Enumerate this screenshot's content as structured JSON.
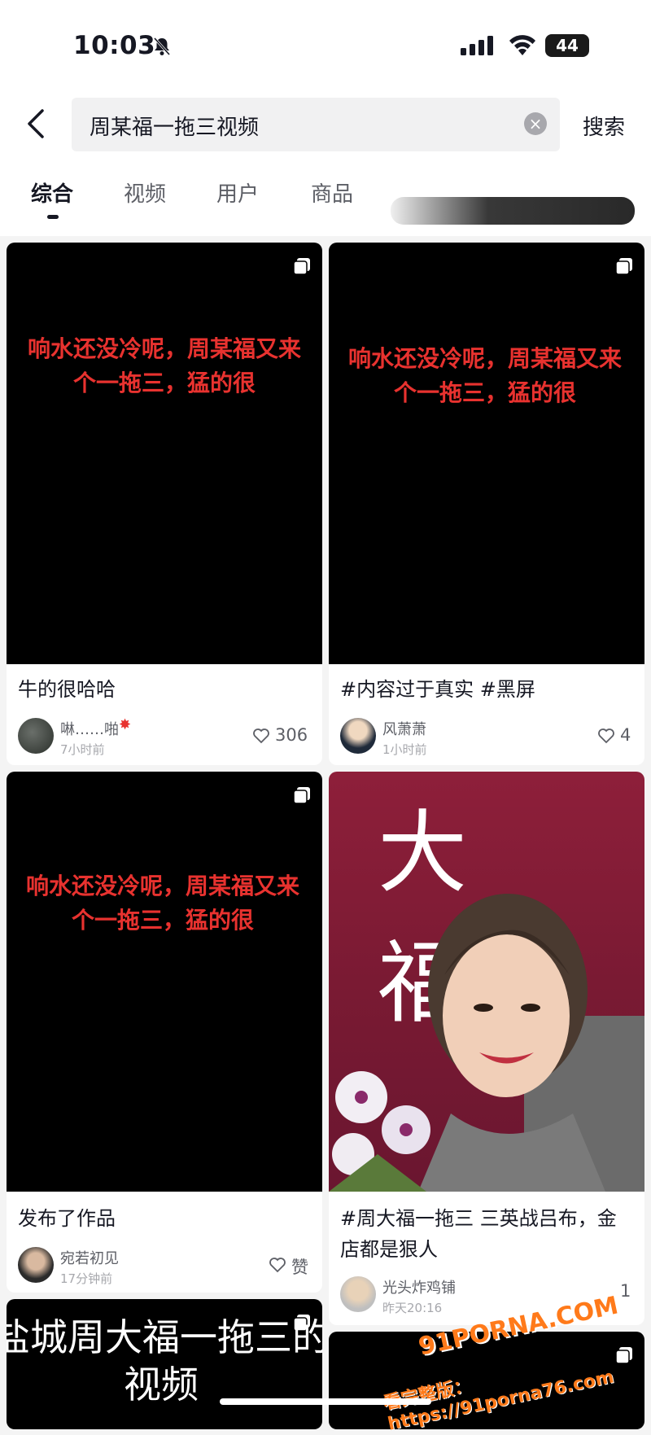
{
  "status": {
    "time": "10:03",
    "battery": "44"
  },
  "search": {
    "query": "周某福一拖三视频",
    "button": "搜索"
  },
  "tabs": [
    "综合",
    "视频",
    "用户",
    "商品"
  ],
  "cards": [
    {
      "overlay_text": "响水还没冷呢，周某福又来个一拖三，猛的很",
      "title": "牛的很哈哈",
      "author": "啉……啪",
      "time": "7小时前",
      "likes": "306"
    },
    {
      "overlay_text": "响水还没冷呢，周某福又来个一拖三，猛的很",
      "title": "#内容过于真实 #黑屏",
      "author": "风萧萧",
      "time": "1小时前",
      "likes": "4"
    },
    {
      "overlay_text": "响水还没冷呢，周某福又来个一拖三，猛的很",
      "title": "发布了作品",
      "author": "宛若初见",
      "time": "17分钟前",
      "likes": "赞"
    },
    {
      "sign_text": "大 福",
      "title": "#周大福一拖三 三英战吕布，金店都是狠人",
      "author": "光头炸鸡铺",
      "time": "昨天20:16",
      "likes": "1"
    },
    {
      "overlay_text": "盐城周大福一拖三的视频"
    }
  ],
  "watermark": {
    "logo": "91PORNA.COM",
    "line2": "看完整版：https://91porna76.com"
  },
  "colors": {
    "accent_red": "#e8322f",
    "text": "#161823",
    "secondary": "#5d5f66"
  }
}
